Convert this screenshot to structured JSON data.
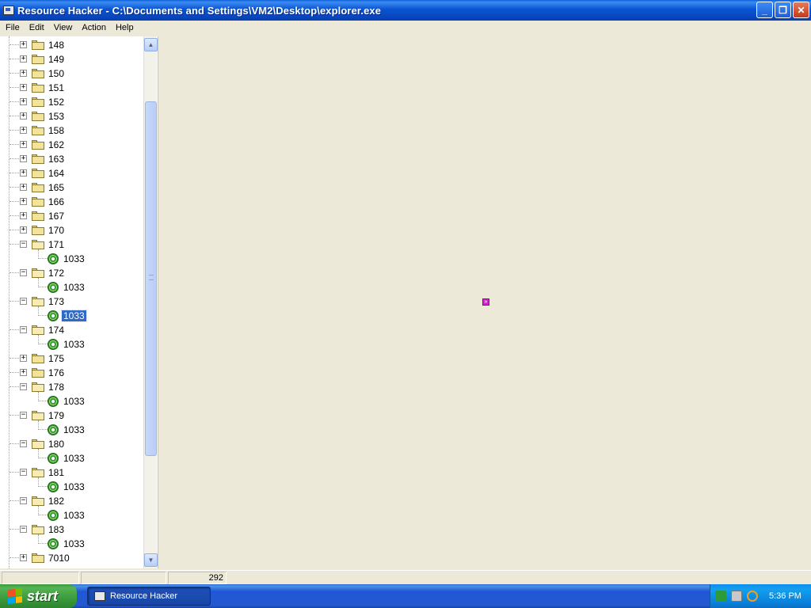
{
  "window": {
    "title": "Resource Hacker  -  C:\\Documents and Settings\\VM2\\Desktop\\explorer.exe",
    "minimize_label": "_",
    "maximize_label": "❐",
    "close_label": "✕"
  },
  "menu": [
    "File",
    "Edit",
    "View",
    "Action",
    "Help"
  ],
  "tree": {
    "nodes": [
      {
        "label": "148",
        "state": "collapsed"
      },
      {
        "label": "149",
        "state": "collapsed"
      },
      {
        "label": "150",
        "state": "collapsed"
      },
      {
        "label": "151",
        "state": "collapsed"
      },
      {
        "label": "152",
        "state": "collapsed"
      },
      {
        "label": "153",
        "state": "collapsed"
      },
      {
        "label": "158",
        "state": "collapsed"
      },
      {
        "label": "162",
        "state": "collapsed"
      },
      {
        "label": "163",
        "state": "collapsed"
      },
      {
        "label": "164",
        "state": "collapsed"
      },
      {
        "label": "165",
        "state": "collapsed"
      },
      {
        "label": "166",
        "state": "collapsed"
      },
      {
        "label": "167",
        "state": "collapsed"
      },
      {
        "label": "170",
        "state": "collapsed"
      },
      {
        "label": "171",
        "state": "expanded",
        "child": "1033"
      },
      {
        "label": "172",
        "state": "expanded",
        "child": "1033"
      },
      {
        "label": "173",
        "state": "expanded",
        "child": "1033",
        "child_selected": true
      },
      {
        "label": "174",
        "state": "expanded",
        "child": "1033"
      },
      {
        "label": "175",
        "state": "collapsed"
      },
      {
        "label": "176",
        "state": "collapsed"
      },
      {
        "label": "178",
        "state": "expanded",
        "child": "1033"
      },
      {
        "label": "179",
        "state": "expanded",
        "child": "1033"
      },
      {
        "label": "180",
        "state": "expanded",
        "child": "1033"
      },
      {
        "label": "181",
        "state": "expanded",
        "child": "1033"
      },
      {
        "label": "182",
        "state": "expanded",
        "child": "1033"
      },
      {
        "label": "183",
        "state": "expanded",
        "child": "1033"
      },
      {
        "label": "7010",
        "state": "collapsed"
      }
    ],
    "selected": "1033"
  },
  "scrollbar": {
    "up_arrow": "▲",
    "down_arrow": "▼"
  },
  "content": {
    "marker_glyph": "»"
  },
  "statusbar": {
    "cells": [
      "",
      "",
      "292"
    ]
  },
  "taskbar": {
    "start_label": "start",
    "task_label": "Resource Hacker",
    "clock": "5:36 PM"
  },
  "colors": {
    "titlebar": "#0a54d2",
    "selection": "#316ac5",
    "marker": "#d21fd2",
    "start": "#3b9a3b"
  }
}
